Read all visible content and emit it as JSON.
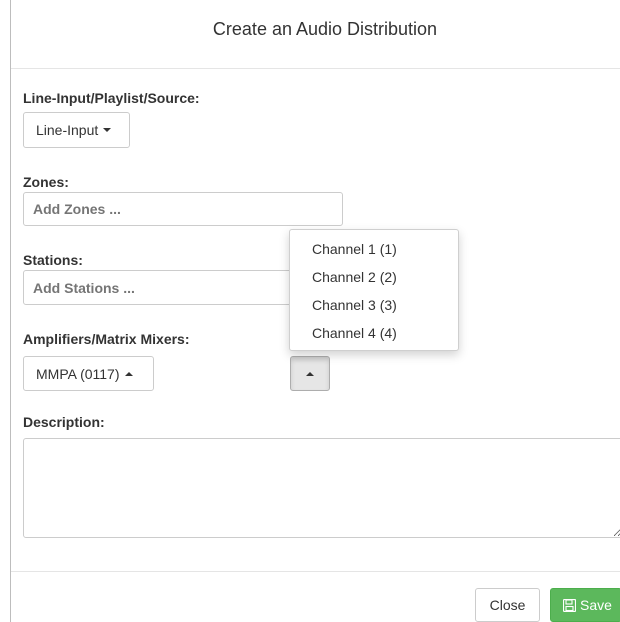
{
  "modal": {
    "title": "Create an Audio Distribution"
  },
  "source": {
    "label": "Line-Input/Playlist/Source:",
    "selected": "Line-Input"
  },
  "zones": {
    "label": "Zones:",
    "placeholder": "Add Zones ..."
  },
  "stations": {
    "label": "Stations:",
    "placeholder": "Add Stations ..."
  },
  "amplifiers": {
    "label": "Amplifiers/Matrix Mixers:",
    "selected": "MMPA (0117)"
  },
  "channel_dropdown": {
    "items": [
      "Channel 1 (1)",
      "Channel 2 (2)",
      "Channel 3 (3)",
      "Channel 4 (4)"
    ]
  },
  "description": {
    "label": "Description:",
    "value": ""
  },
  "footer": {
    "close_label": "Close",
    "save_label": "Save"
  },
  "colors": {
    "save_green": "#5cb85c",
    "border": "#cccccc"
  }
}
